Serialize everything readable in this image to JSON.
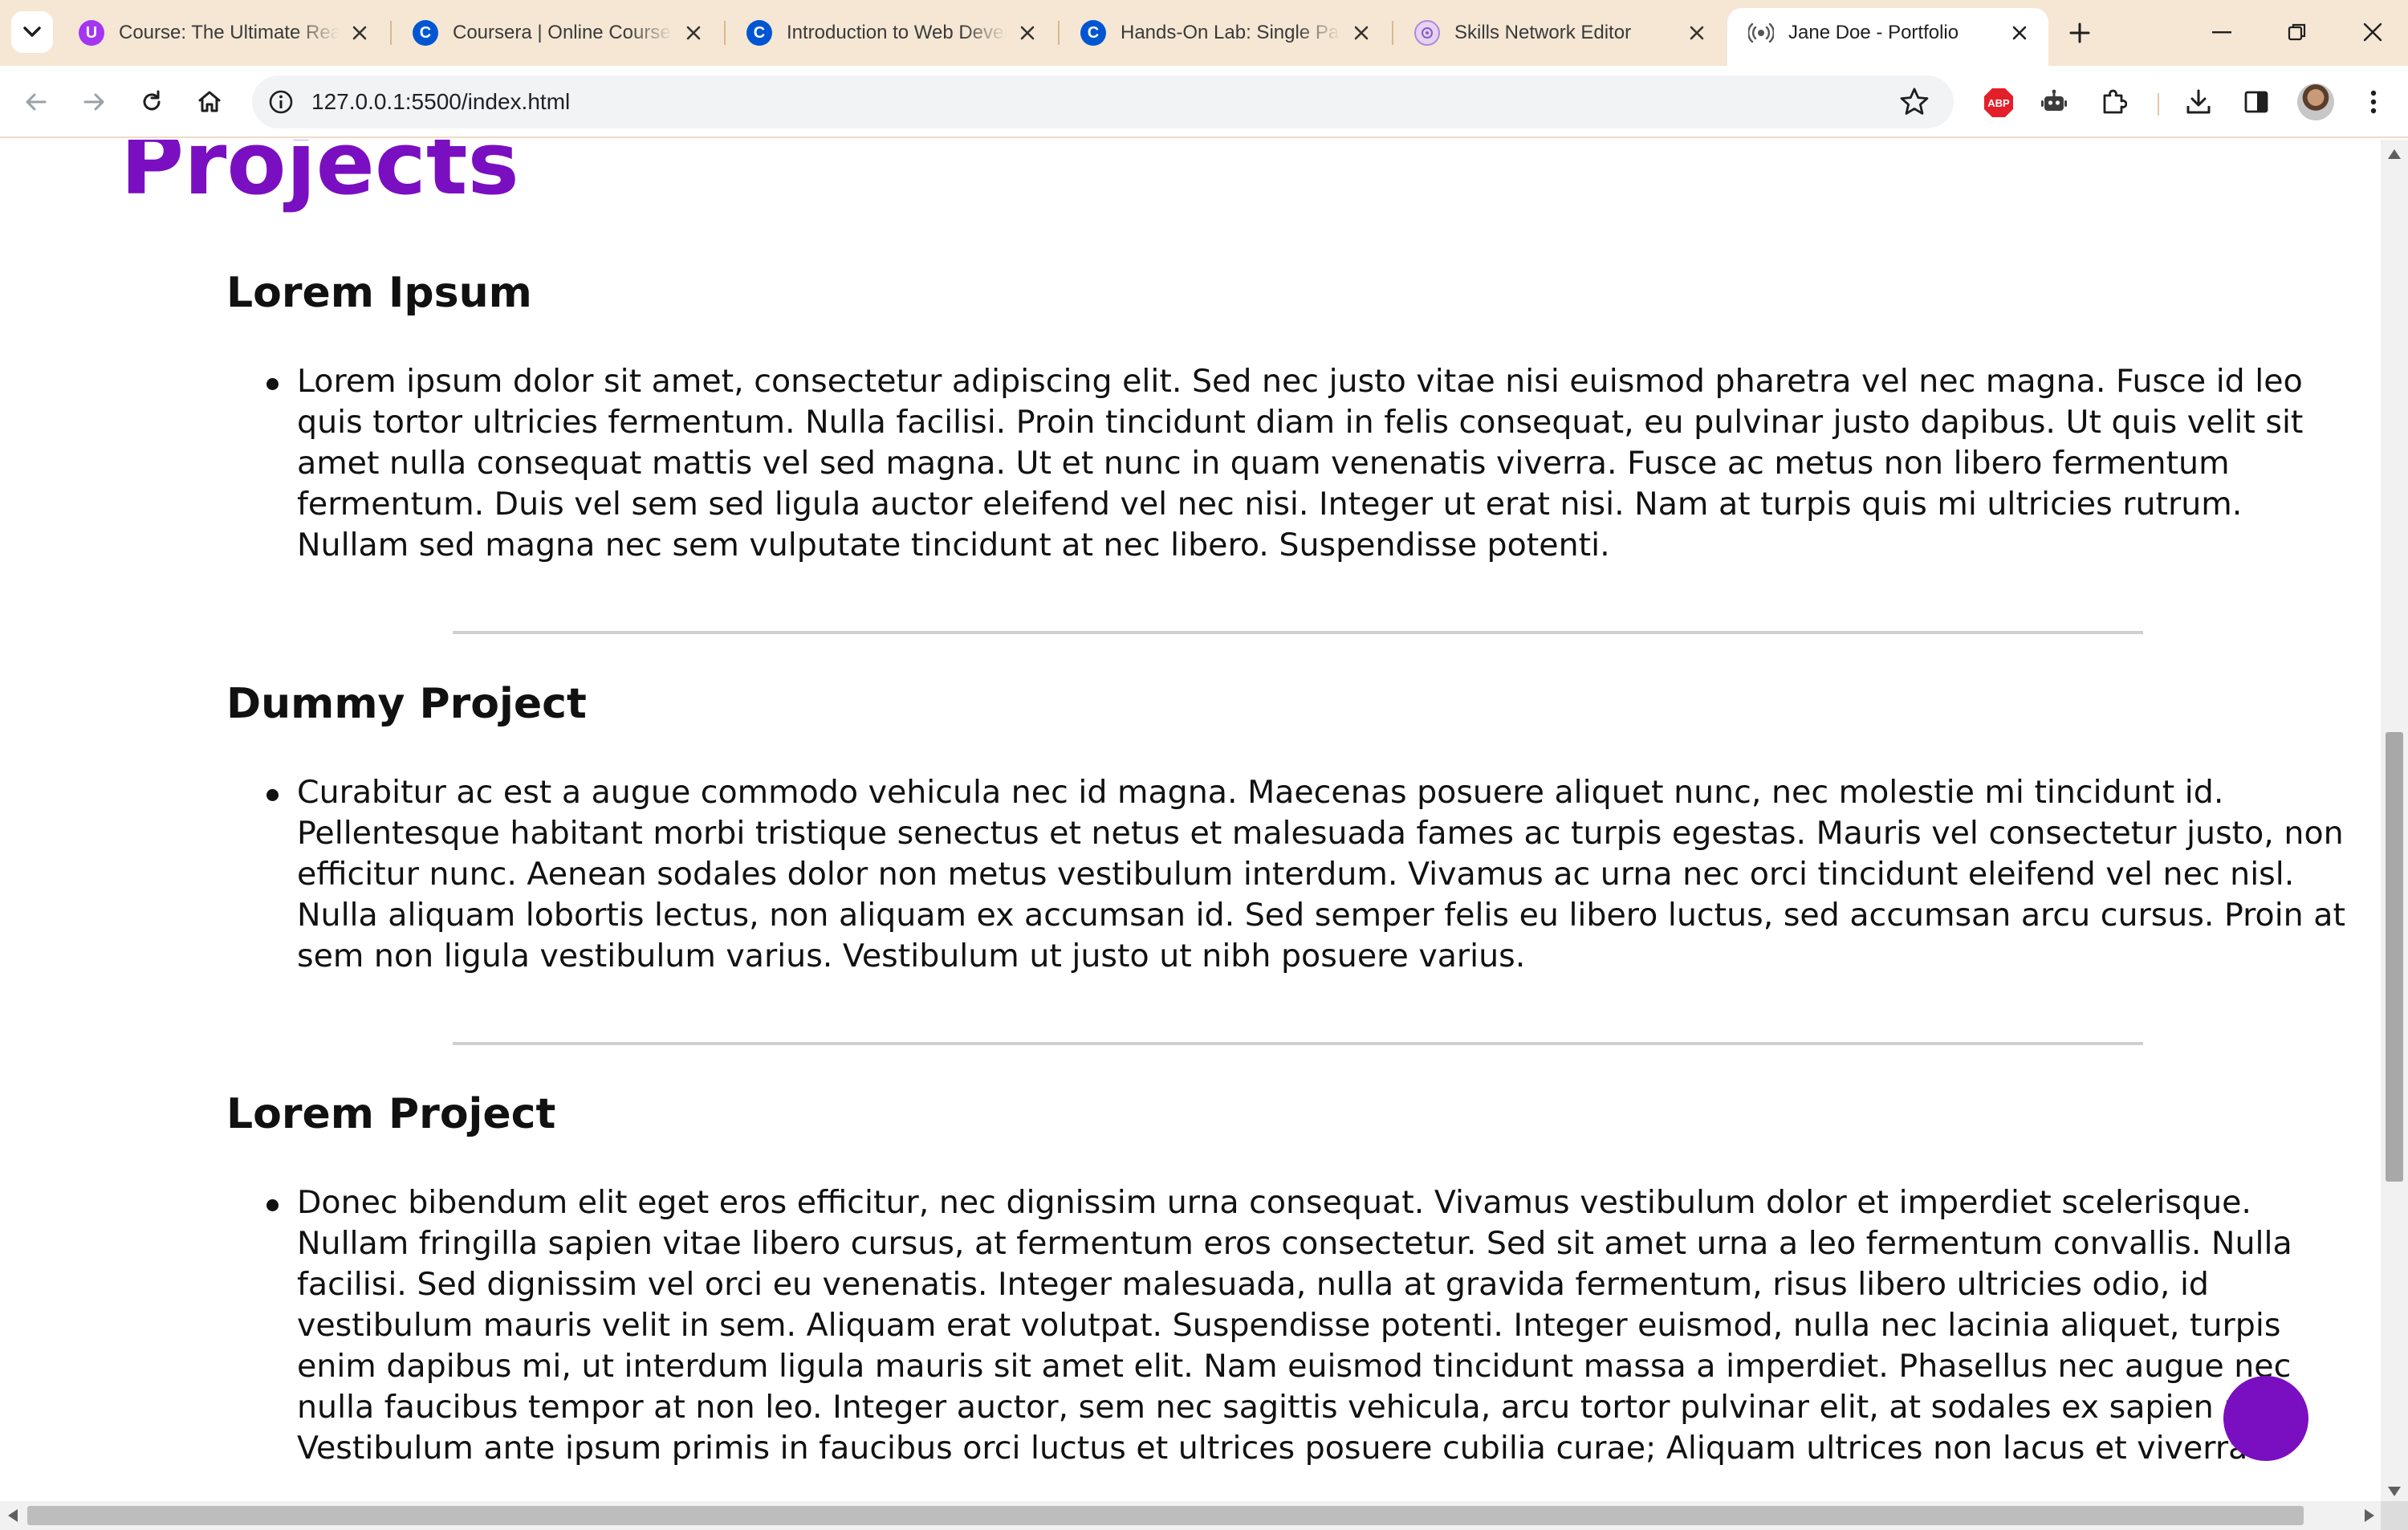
{
  "browser": {
    "tabs": [
      {
        "title": "Course: The Ultimate React",
        "favicon": "udemy-icon",
        "color": "#a435f0",
        "active": false
      },
      {
        "title": "Coursera | Online Courses",
        "favicon": "coursera-icon",
        "color": "#0056d2",
        "active": false
      },
      {
        "title": "Introduction to Web Development",
        "favicon": "coursera-icon",
        "color": "#0056d2",
        "active": false
      },
      {
        "title": "Hands-On Lab: Single Page",
        "favicon": "coursera-icon",
        "color": "#0056d2",
        "active": false
      },
      {
        "title": "Skills Network Editor",
        "favicon": "skills-network-icon",
        "color": "#b08ad8",
        "active": false
      },
      {
        "title": "Jane Doe - Portfolio",
        "favicon": "live-server-icon",
        "color": "#555555",
        "active": true
      }
    ],
    "address_bar": {
      "url": "127.0.0.1:5500/index.html"
    },
    "extensions": [
      "adblock-icon",
      "robot-icon",
      "puzzle-icon"
    ],
    "accent_color": "#f5e7d4"
  },
  "page": {
    "section_title": "Projects",
    "accent_color": "#7a0fc1",
    "projects": [
      {
        "title": "Lorem Ipsum",
        "description": "Lorem ipsum dolor sit amet, consectetur adipiscing elit. Sed nec justo vitae nisi euismod pharetra vel nec magna. Fusce id leo quis tortor ultricies fermentum. Nulla facilisi. Proin tincidunt diam in felis consequat, eu pulvinar justo dapibus. Ut quis velit sit amet nulla consequat mattis vel sed magna. Ut et nunc in quam venenatis viverra. Fusce ac metus non libero fermentum fermentum. Duis vel sem sed ligula auctor eleifend vel nec nisi. Integer ut erat nisi. Nam at turpis quis mi ultricies rutrum. Nullam sed magna nec sem vulputate tincidunt at nec libero. Suspendisse potenti."
      },
      {
        "title": "Dummy Project",
        "description": "Curabitur ac est a augue commodo vehicula nec id magna. Maecenas posuere aliquet nunc, nec molestie mi tincidunt id. Pellentesque habitant morbi tristique senectus et netus et malesuada fames ac turpis egestas. Mauris vel consectetur justo, non efficitur nunc. Aenean sodales dolor non metus vestibulum interdum. Vivamus ac urna nec orci tincidunt eleifend vel nec nisl. Nulla aliquam lobortis lectus, non aliquam ex accumsan id. Sed semper felis eu libero luctus, sed accumsan arcu cursus. Proin at sem non ligula vestibulum varius. Vestibulum ut justo ut nibh posuere varius."
      },
      {
        "title": "Lorem Project",
        "description": "Donec bibendum elit eget eros efficitur, nec dignissim urna consequat. Vivamus vestibulum dolor et imperdiet scelerisque. Nullam fringilla sapien vitae libero cursus, at fermentum eros consectetur. Sed sit amet urna a leo fermentum convallis. Nulla facilisi. Sed dignissim vel orci eu venenatis. Integer malesuada, nulla at gravida fermentum, risus libero ultricies odio, id vestibulum mauris velit in sem. Aliquam erat volutpat. Suspendisse potenti. Integer euismod, nulla nec lacinia aliquet, turpis enim dapibus mi, ut interdum ligula mauris sit amet elit. Nam euismod tincidunt massa a imperdiet. Phasellus nec augue nec nulla faucibus tempor at non leo. Integer auctor, sem nec sagittis vehicula, arcu tortor pulvinar elit, at sodales ex sapien nec. Vestibulum ante ipsum primis in faucibus orci luctus et ultrices posuere cubilia curae; Aliquam ultrices non lacus et viverra."
      }
    ]
  }
}
